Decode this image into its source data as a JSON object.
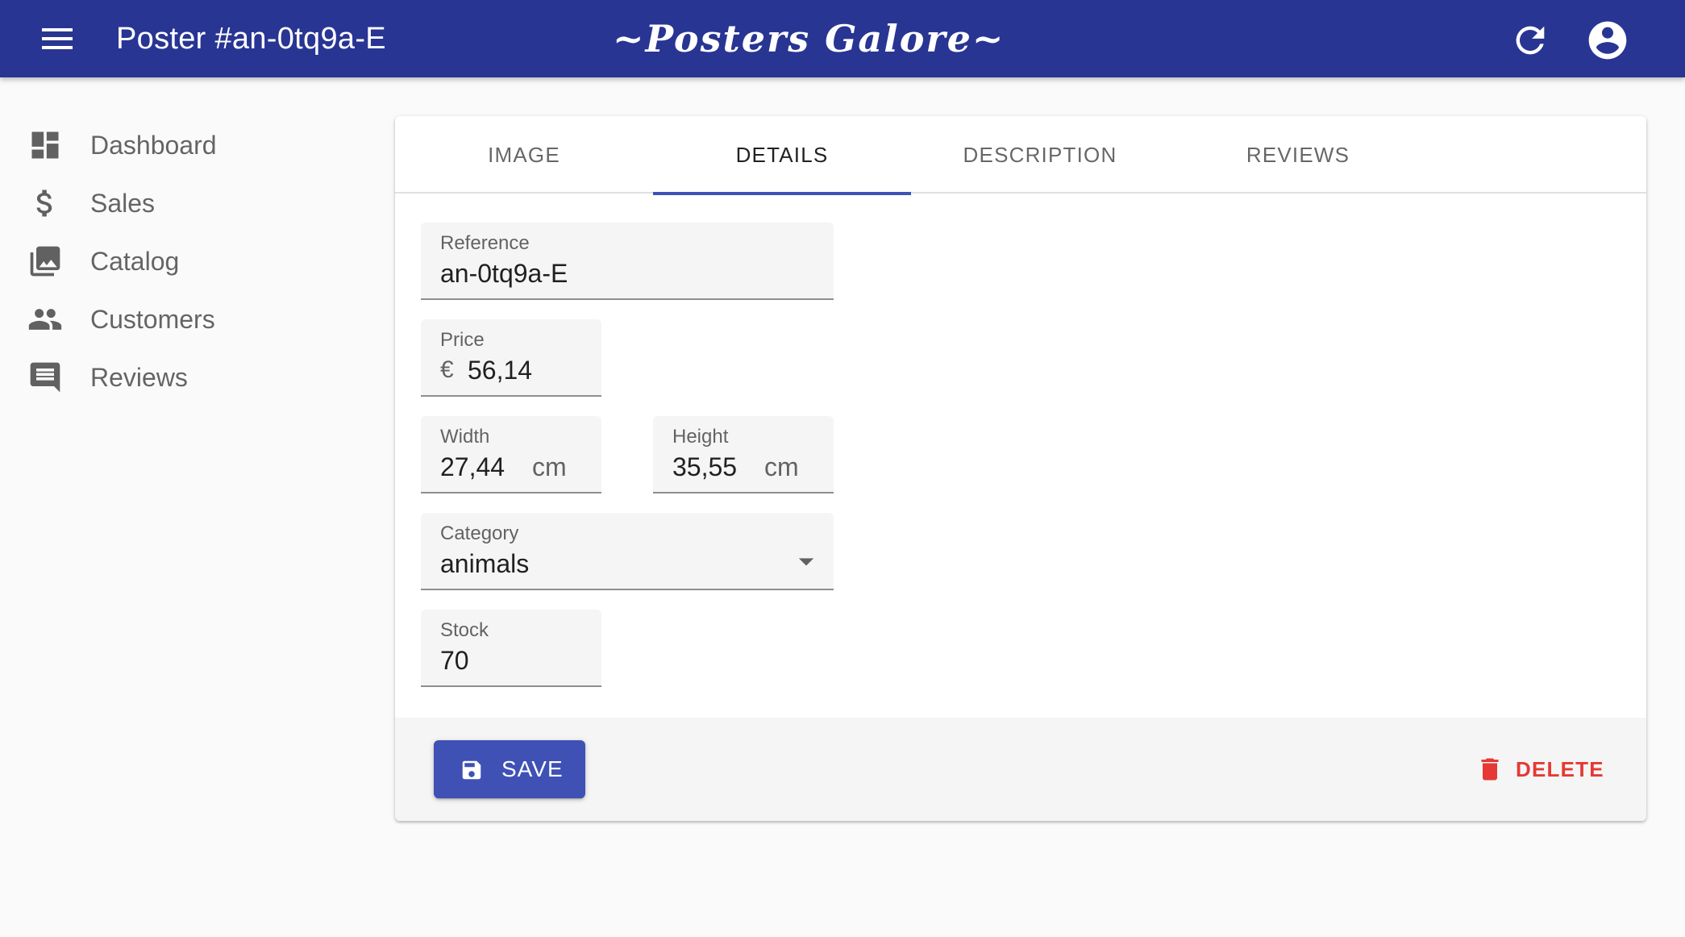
{
  "appbar": {
    "title": "Poster #an-0tq9a-E",
    "brand": "~Posters Galore~"
  },
  "sidebar": {
    "items": [
      {
        "label": "Dashboard",
        "icon": "dashboard-icon"
      },
      {
        "label": "Sales",
        "icon": "dollar-icon"
      },
      {
        "label": "Catalog",
        "icon": "photo-library-icon"
      },
      {
        "label": "Customers",
        "icon": "people-icon"
      },
      {
        "label": "Reviews",
        "icon": "comment-icon"
      }
    ]
  },
  "tabs": [
    {
      "label": "IMAGE",
      "active": false
    },
    {
      "label": "DETAILS",
      "active": true
    },
    {
      "label": "DESCRIPTION",
      "active": false
    },
    {
      "label": "REVIEWS",
      "active": false
    }
  ],
  "form": {
    "reference": {
      "label": "Reference",
      "value": "an-0tq9a-E"
    },
    "price": {
      "label": "Price",
      "prefix": "€",
      "value": "56,14"
    },
    "width": {
      "label": "Width",
      "value": "27,44",
      "unit": "cm"
    },
    "height": {
      "label": "Height",
      "value": "35,55",
      "unit": "cm"
    },
    "category": {
      "label": "Category",
      "value": "animals"
    },
    "stock": {
      "label": "Stock",
      "value": "70"
    }
  },
  "toolbar": {
    "save_label": "SAVE",
    "delete_label": "DELETE"
  },
  "colors": {
    "appbar": "#283593",
    "primary": "#3f51b5",
    "danger": "#e53935"
  }
}
